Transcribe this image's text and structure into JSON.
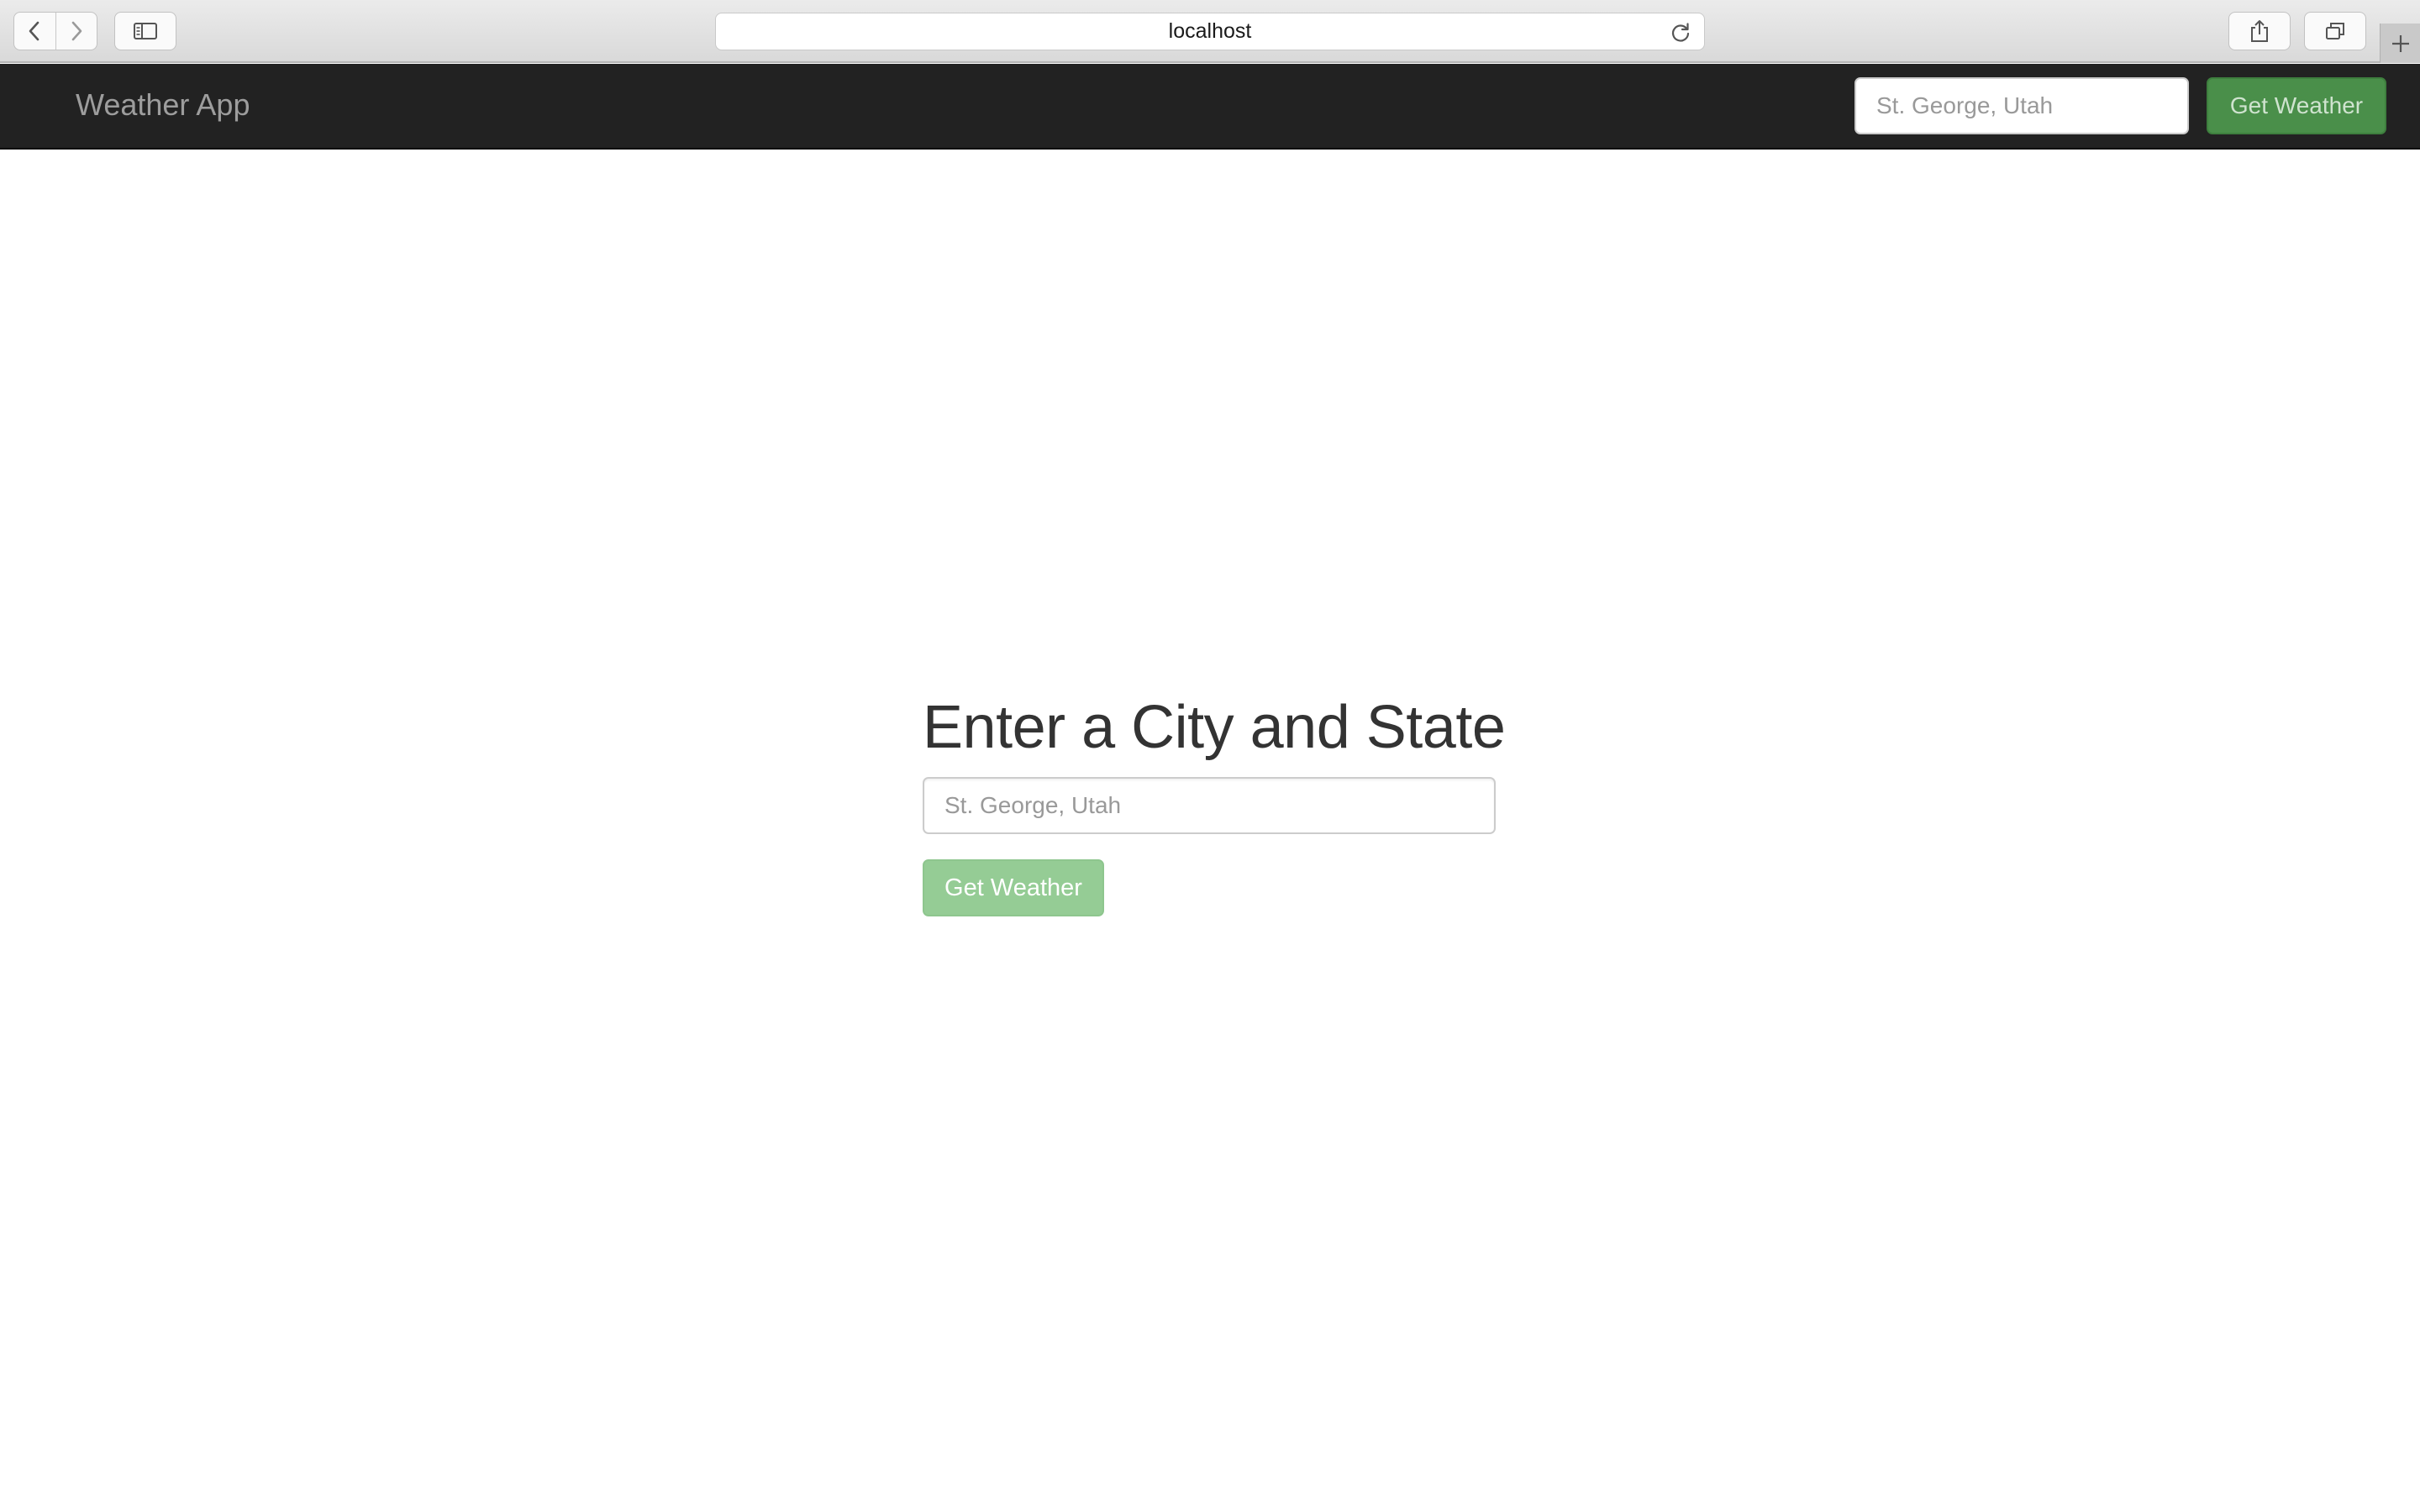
{
  "browser": {
    "url": "localhost",
    "icons": {
      "back": "chevron-left-icon",
      "forward": "chevron-right-icon",
      "sidebar": "sidebar-icon",
      "reload": "reload-icon",
      "share": "share-icon",
      "tabs": "tabs-overview-icon",
      "new_tab": "plus-icon"
    }
  },
  "navbar": {
    "brand": "Weather App",
    "search_placeholder": "St. George, Utah",
    "button_label": "Get Weather"
  },
  "main": {
    "heading": "Enter a City and State",
    "input_placeholder": "St. George, Utah",
    "button_label": "Get Weather"
  },
  "colors": {
    "navbar_bg": "#222222",
    "brand_text": "#9d9d9d",
    "nav_button_bg": "#4a8f4a",
    "main_button_bg": "#95cc95",
    "heading_text": "#333333"
  }
}
